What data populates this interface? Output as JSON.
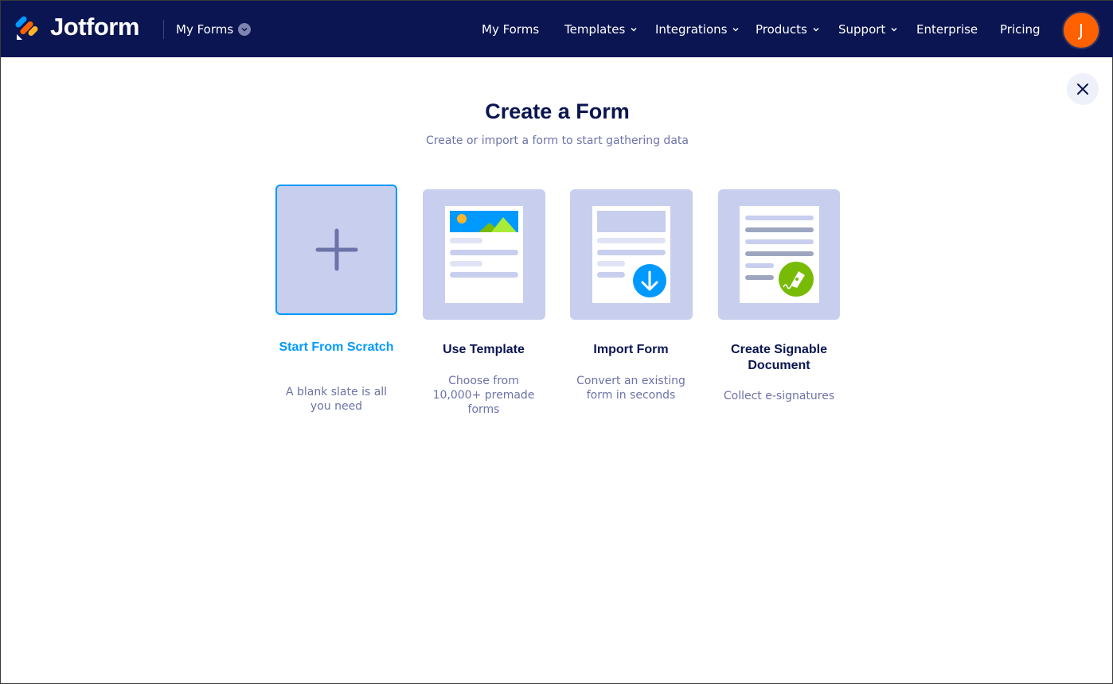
{
  "header": {
    "brand": "Jotform",
    "switcher_label": "My Forms",
    "nav": [
      {
        "label": "My Forms",
        "has_dropdown": false
      },
      {
        "label": "Templates",
        "has_dropdown": true
      },
      {
        "label": "Integrations",
        "has_dropdown": true
      },
      {
        "label": "Products",
        "has_dropdown": true
      },
      {
        "label": "Support",
        "has_dropdown": true
      },
      {
        "label": "Enterprise",
        "has_dropdown": false
      },
      {
        "label": "Pricing",
        "has_dropdown": false
      }
    ],
    "avatar_initial": "J"
  },
  "modal": {
    "title": "Create a Form",
    "subtitle": "Create or import a form to start gathering data",
    "close_icon": "close-icon",
    "options": [
      {
        "title": "Start From Scratch",
        "description": "A blank slate is all you need",
        "icon": "plus-icon",
        "selected": true
      },
      {
        "title": "Use Template",
        "description": "Choose from 10,000+ premade forms",
        "icon": "template-illustration",
        "selected": false
      },
      {
        "title": "Import Form",
        "description": "Convert an existing form in seconds",
        "icon": "import-illustration",
        "selected": false
      },
      {
        "title": "Create Signable Document",
        "description": "Collect e-signatures",
        "icon": "signable-document-illustration",
        "selected": false
      }
    ]
  },
  "colors": {
    "nav_background": "#0a1551",
    "accent_blue": "#0099ff",
    "tile_background": "#c8ceed",
    "avatar": "#ff6100",
    "signature_green": "#78bb07"
  }
}
